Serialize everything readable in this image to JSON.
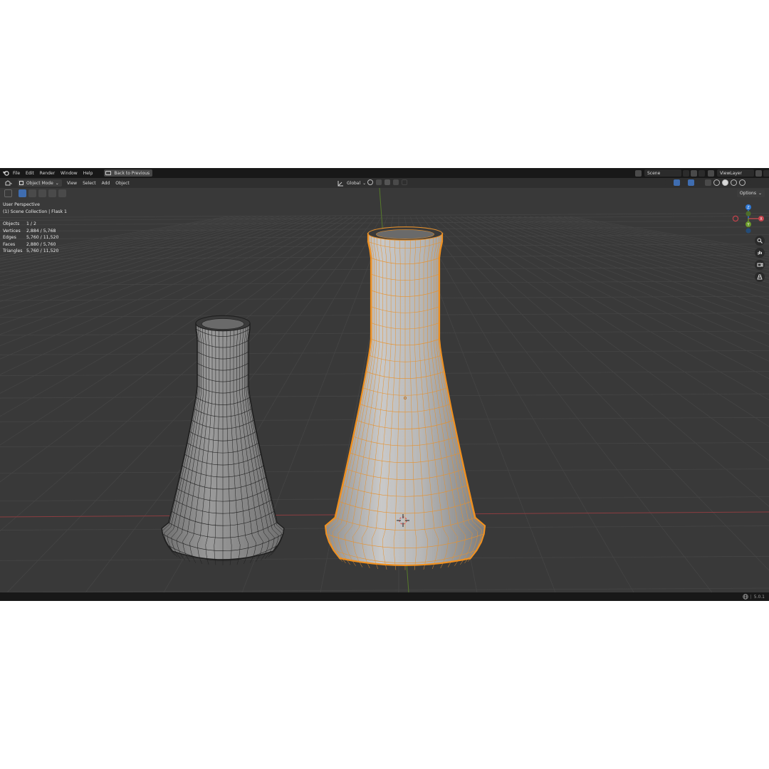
{
  "menu": {
    "items": [
      "File",
      "Edit",
      "Render",
      "Window",
      "Help"
    ],
    "back_button": "Back to Previous"
  },
  "scene": {
    "name": "Scene"
  },
  "view_layer": {
    "name": "ViewLayer"
  },
  "header": {
    "mode": "Object Mode",
    "items": [
      "View",
      "Select",
      "Add",
      "Object"
    ],
    "transform_orientation": "Global",
    "options_label": "Options"
  },
  "viewport": {
    "perspective": "User Perspective",
    "collection": "(1) Scene Collection | Flask 1",
    "stats": [
      {
        "label": "Objects",
        "value": "1 / 2"
      },
      {
        "label": "Vertices",
        "value": "2,884 / 5,768"
      },
      {
        "label": "Edges",
        "value": "5,760 / 11,520"
      },
      {
        "label": "Faces",
        "value": "2,880 / 5,760"
      },
      {
        "label": "Triangles",
        "value": "5,760 / 11,520"
      }
    ],
    "gizmo": {
      "x": "X",
      "y": "Y",
      "z": "Z"
    },
    "colors": {
      "background": "#393939",
      "selection_outline": "#f0901f",
      "x_axis": "#b84a4e",
      "y_axis": "#6b9a2b",
      "z_axis": "#2e78d6"
    }
  },
  "status": {
    "version": "5.0.1"
  }
}
